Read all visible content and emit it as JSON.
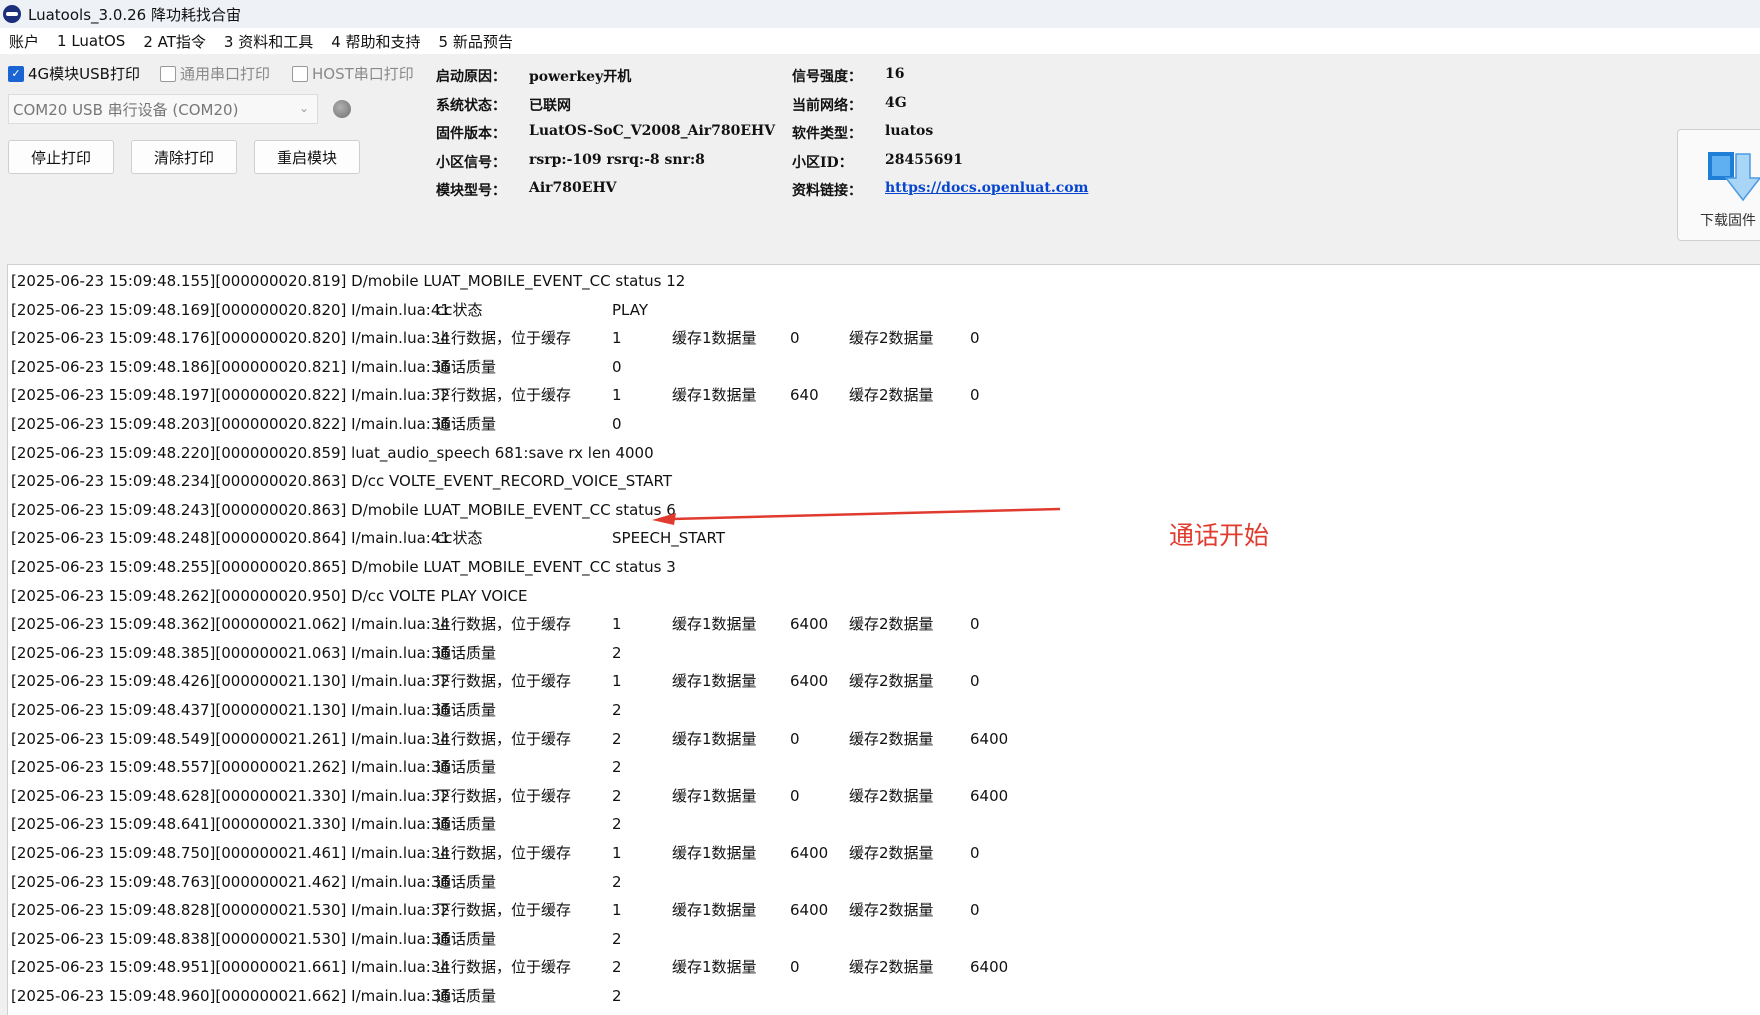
{
  "window": {
    "title": "Luatools_3.0.26 降功耗找合宙"
  },
  "menu": [
    "账户",
    "1 LuatOS",
    "2 AT指令",
    "3 资料和工具",
    "4 帮助和支持",
    "5 新品预告"
  ],
  "options": {
    "usb_print": {
      "label": "4G模块USB打印",
      "checked": true
    },
    "serial_print": {
      "label": "通用串口打印",
      "checked": false
    },
    "host_print": {
      "label": "HOST串口打印",
      "checked": false
    }
  },
  "port_select": {
    "value": "COM20 USB 串行设备 (COM20)"
  },
  "buttons": {
    "stop": "停止打印",
    "clear": "清除打印",
    "restart": "重启模块",
    "download": "下载固件"
  },
  "info_left": [
    {
      "key": "启动原因：",
      "value": "powerkey开机"
    },
    {
      "key": "系统状态：",
      "value": "已联网"
    },
    {
      "key": "固件版本：",
      "value": "LuatOS-SoC_V2008_Air780EHV"
    },
    {
      "key": "小区信号：",
      "value": "rsrp:-109 rsrq:-8 snr:8"
    },
    {
      "key": "模块型号：",
      "value": "Air780EHV"
    }
  ],
  "info_right": [
    {
      "key": "信号强度：",
      "value": "16"
    },
    {
      "key": "当前网络：",
      "value": "4G"
    },
    {
      "key": "软件类型：",
      "value": "luatos"
    },
    {
      "key": "小区ID：",
      "value": "28455691"
    },
    {
      "key": "资料链接：",
      "value": "https://docs.openluat.com"
    }
  ],
  "search": {
    "value": ""
  },
  "annotation": {
    "text": "通话开始",
    "color": "#e03b2e"
  },
  "log_rows": [
    {
      "prefix": "[2025-06-23 15:09:48.155][000000020.819] D/mobile LUAT_MOBILE_EVENT_CC status 12"
    },
    {
      "prefix": "[2025-06-23 15:09:48.169][000000020.820] I/main.lua:41",
      "c1": "cc状态",
      "c2": "PLAY"
    },
    {
      "prefix": "[2025-06-23 15:09:48.176][000000020.820] I/main.lua:34",
      "c1": "上行数据，位于缓存",
      "c2": "1",
      "c3": "缓存1数据量",
      "c4": "0",
      "c5": "缓存2数据量",
      "c6": "0"
    },
    {
      "prefix": "[2025-06-23 15:09:48.186][000000020.821] I/main.lua:36",
      "c1": "通话质量",
      "c2": "0"
    },
    {
      "prefix": "[2025-06-23 15:09:48.197][000000020.822] I/main.lua:32",
      "c1": "下行数据，位于缓存",
      "c2": "1",
      "c3": "缓存1数据量",
      "c4": "640",
      "c5": "缓存2数据量",
      "c6": "0"
    },
    {
      "prefix": "[2025-06-23 15:09:48.203][000000020.822] I/main.lua:36",
      "c1": "通话质量",
      "c2": "0"
    },
    {
      "prefix": "[2025-06-23 15:09:48.220][000000020.859] luat_audio_speech 681:save rx len 4000"
    },
    {
      "prefix": "[2025-06-23 15:09:48.234][000000020.863] D/cc VOLTE_EVENT_RECORD_VOICE_START"
    },
    {
      "prefix": "[2025-06-23 15:09:48.243][000000020.863] D/mobile LUAT_MOBILE_EVENT_CC status 6"
    },
    {
      "prefix": "[2025-06-23 15:09:48.248][000000020.864] I/main.lua:41",
      "c1": "cc状态",
      "c2": "SPEECH_START"
    },
    {
      "prefix": "[2025-06-23 15:09:48.255][000000020.865] D/mobile LUAT_MOBILE_EVENT_CC status 3"
    },
    {
      "prefix": "[2025-06-23 15:09:48.262][000000020.950] D/cc VOLTE PLAY VOICE"
    },
    {
      "prefix": "[2025-06-23 15:09:48.362][000000021.062] I/main.lua:34",
      "c1": "上行数据，位于缓存",
      "c2": "1",
      "c3": "缓存1数据量",
      "c4": "6400",
      "c5": "缓存2数据量",
      "c6": "0"
    },
    {
      "prefix": "[2025-06-23 15:09:48.385][000000021.063] I/main.lua:36",
      "c1": "通话质量",
      "c2": "2"
    },
    {
      "prefix": "[2025-06-23 15:09:48.426][000000021.130] I/main.lua:32",
      "c1": "下行数据，位于缓存",
      "c2": "1",
      "c3": "缓存1数据量",
      "c4": "6400",
      "c5": "缓存2数据量",
      "c6": "0"
    },
    {
      "prefix": "[2025-06-23 15:09:48.437][000000021.130] I/main.lua:36",
      "c1": "通话质量",
      "c2": "2"
    },
    {
      "prefix": "[2025-06-23 15:09:48.549][000000021.261] I/main.lua:34",
      "c1": "上行数据，位于缓存",
      "c2": "2",
      "c3": "缓存1数据量",
      "c4": "0",
      "c5": "缓存2数据量",
      "c6": "6400"
    },
    {
      "prefix": "[2025-06-23 15:09:48.557][000000021.262] I/main.lua:36",
      "c1": "通话质量",
      "c2": "2"
    },
    {
      "prefix": "[2025-06-23 15:09:48.628][000000021.330] I/main.lua:32",
      "c1": "下行数据，位于缓存",
      "c2": "2",
      "c3": "缓存1数据量",
      "c4": "0",
      "c5": "缓存2数据量",
      "c6": "6400"
    },
    {
      "prefix": "[2025-06-23 15:09:48.641][000000021.330] I/main.lua:36",
      "c1": "通话质量",
      "c2": "2"
    },
    {
      "prefix": "[2025-06-23 15:09:48.750][000000021.461] I/main.lua:34",
      "c1": "上行数据，位于缓存",
      "c2": "1",
      "c3": "缓存1数据量",
      "c4": "6400",
      "c5": "缓存2数据量",
      "c6": "0"
    },
    {
      "prefix": "[2025-06-23 15:09:48.763][000000021.462] I/main.lua:36",
      "c1": "通话质量",
      "c2": "2"
    },
    {
      "prefix": "[2025-06-23 15:09:48.828][000000021.530] I/main.lua:32",
      "c1": "下行数据，位于缓存",
      "c2": "1",
      "c3": "缓存1数据量",
      "c4": "6400",
      "c5": "缓存2数据量",
      "c6": "0"
    },
    {
      "prefix": "[2025-06-23 15:09:48.838][000000021.530] I/main.lua:36",
      "c1": "通话质量",
      "c2": "2"
    },
    {
      "prefix": "[2025-06-23 15:09:48.951][000000021.661] I/main.lua:34",
      "c1": "上行数据，位于缓存",
      "c2": "2",
      "c3": "缓存1数据量",
      "c4": "0",
      "c5": "缓存2数据量",
      "c6": "6400"
    },
    {
      "prefix": "[2025-06-23 15:09:48.960][000000021.662] I/main.lua:36",
      "c1": "通话质量",
      "c2": "2"
    }
  ]
}
